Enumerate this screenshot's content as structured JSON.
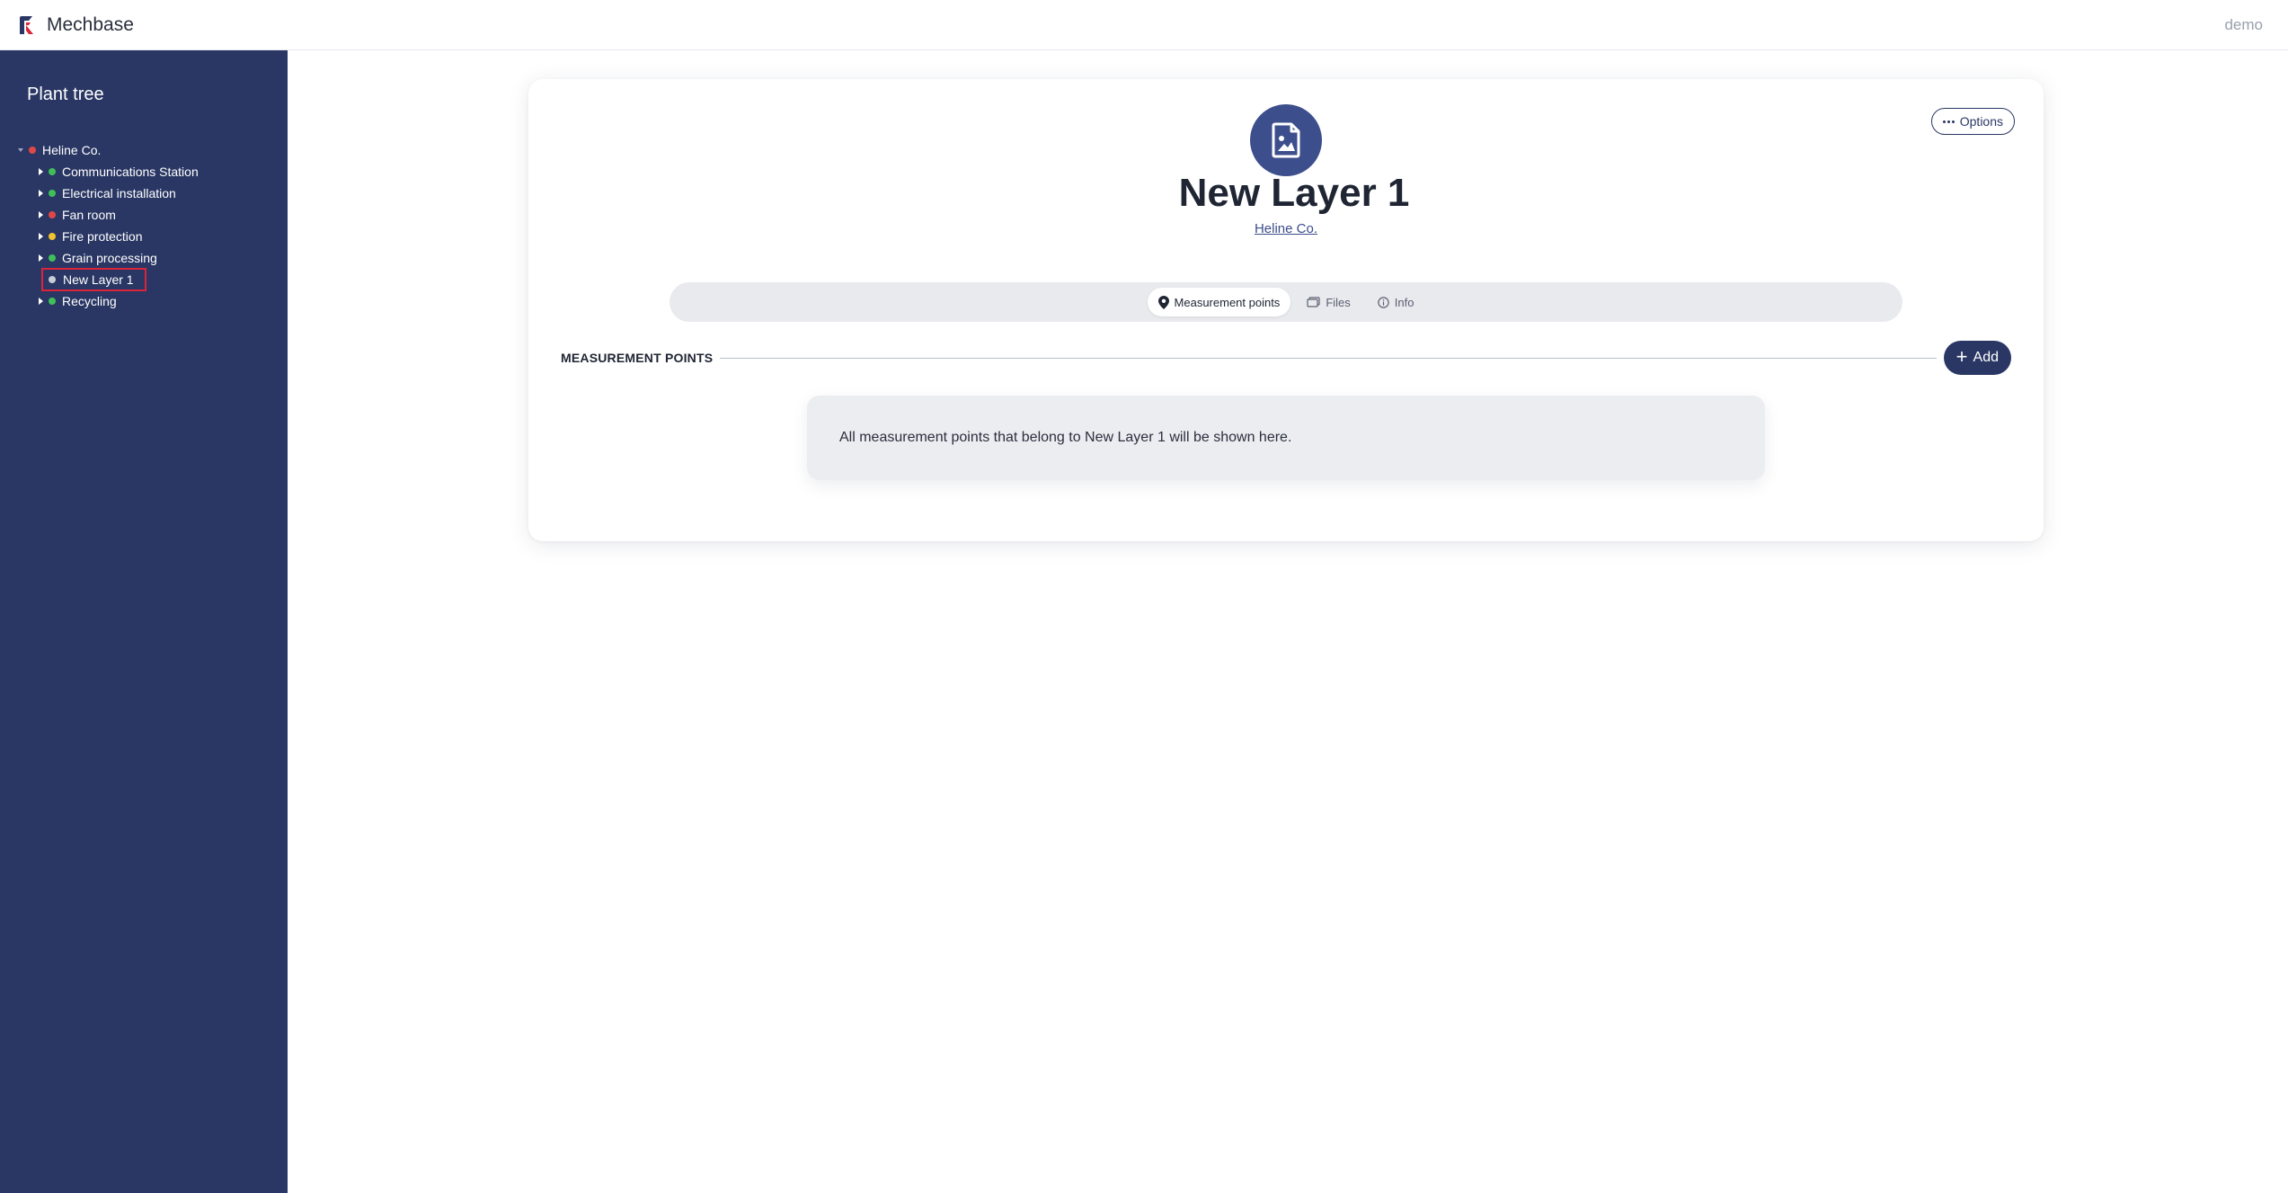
{
  "app": {
    "name": "Mechbase",
    "user": "demo",
    "logo_icon": "mechbase-logo-icon"
  },
  "colors": {
    "sidebar": "#2a3764",
    "accent": "#2a3764",
    "avatar": "#3c4e8c",
    "status_green": "#3fbf5a",
    "status_red": "#e04848",
    "status_yellow": "#f2c230",
    "status_grey": "#c8ccd6",
    "selection_outline": "#d9243a"
  },
  "sidebar": {
    "title": "Plant tree",
    "root": {
      "label": "Heline Co.",
      "status": "red",
      "expanded": true
    },
    "children": [
      {
        "label": "Communications Station",
        "status": "green",
        "has_children": true
      },
      {
        "label": "Electrical installation",
        "status": "green",
        "has_children": true
      },
      {
        "label": "Fan room",
        "status": "red",
        "has_children": true
      },
      {
        "label": "Fire protection",
        "status": "yellow",
        "has_children": true
      },
      {
        "label": "Grain processing",
        "status": "green",
        "has_children": true
      },
      {
        "label": "New Layer 1",
        "status": "grey",
        "has_children": false,
        "selected": true
      },
      {
        "label": "Recycling",
        "status": "green",
        "has_children": true
      }
    ]
  },
  "main": {
    "options_label": "Options",
    "avatar_icon": "image-file-icon",
    "title": "New Layer 1",
    "parent_link": "Heline Co.",
    "tabs": [
      {
        "label": "Measurement points",
        "icon": "map-pin-icon",
        "active": true
      },
      {
        "label": "Files",
        "icon": "files-icon",
        "active": false
      },
      {
        "label": "Info",
        "icon": "info-icon",
        "active": false
      }
    ],
    "section_title": "MEASUREMENT POINTS",
    "add_label": "Add",
    "empty_message": "All measurement points that belong to New Layer 1 will be shown here."
  }
}
